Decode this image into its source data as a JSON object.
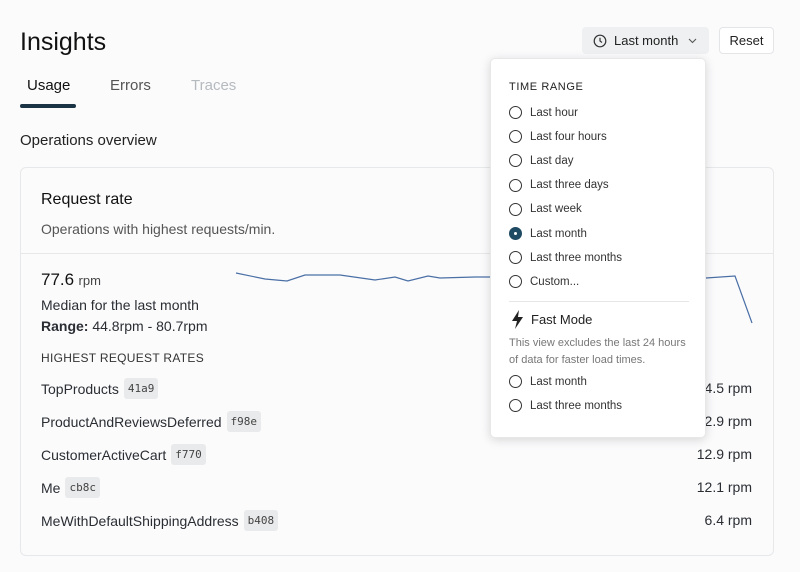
{
  "header": {
    "title": "Insights",
    "time_range_label": "Last month",
    "reset_label": "Reset"
  },
  "tabs": [
    {
      "label": "Usage",
      "state": "active"
    },
    {
      "label": "Errors",
      "state": "normal"
    },
    {
      "label": "Traces",
      "state": "disabled"
    }
  ],
  "section_title": "Operations overview",
  "card": {
    "title": "Request rate",
    "subtitle": "Operations with highest requests/min.",
    "median_value": "77.6",
    "median_unit": "rpm",
    "median_label": "Median for the last month",
    "range_label": "Range:",
    "range_value": "44.8rpm - 80.7rpm",
    "list_header": "HIGHEST REQUEST RATES",
    "operations": [
      {
        "name": "TopProducts",
        "id": "41a9",
        "rate": "14.5 rpm"
      },
      {
        "name": "ProductAndReviewsDeferred",
        "id": "f98e",
        "rate": "12.9 rpm"
      },
      {
        "name": "CustomerActiveCart",
        "id": "f770",
        "rate": "12.9 rpm"
      },
      {
        "name": "Me",
        "id": "cb8c",
        "rate": "12.1 rpm"
      },
      {
        "name": "MeWithDefaultShippingAddress",
        "id": "b408",
        "rate": "6.4 rpm"
      }
    ],
    "sparkline_color": "#4a6fa5"
  },
  "dropdown": {
    "header": "TIME RANGE",
    "options": [
      {
        "label": "Last hour",
        "selected": false
      },
      {
        "label": "Last four hours",
        "selected": false
      },
      {
        "label": "Last day",
        "selected": false
      },
      {
        "label": "Last three days",
        "selected": false
      },
      {
        "label": "Last week",
        "selected": false
      },
      {
        "label": "Last month",
        "selected": true
      },
      {
        "label": "Last three months",
        "selected": false
      },
      {
        "label": "Custom...",
        "selected": false
      }
    ],
    "fast_mode": {
      "title": "Fast Mode",
      "icon": "lightning-icon",
      "description": "This view excludes the last 24 hours of data for faster load times.",
      "options": [
        {
          "label": "Last month",
          "selected": false
        },
        {
          "label": "Last three months",
          "selected": false
        }
      ]
    }
  }
}
